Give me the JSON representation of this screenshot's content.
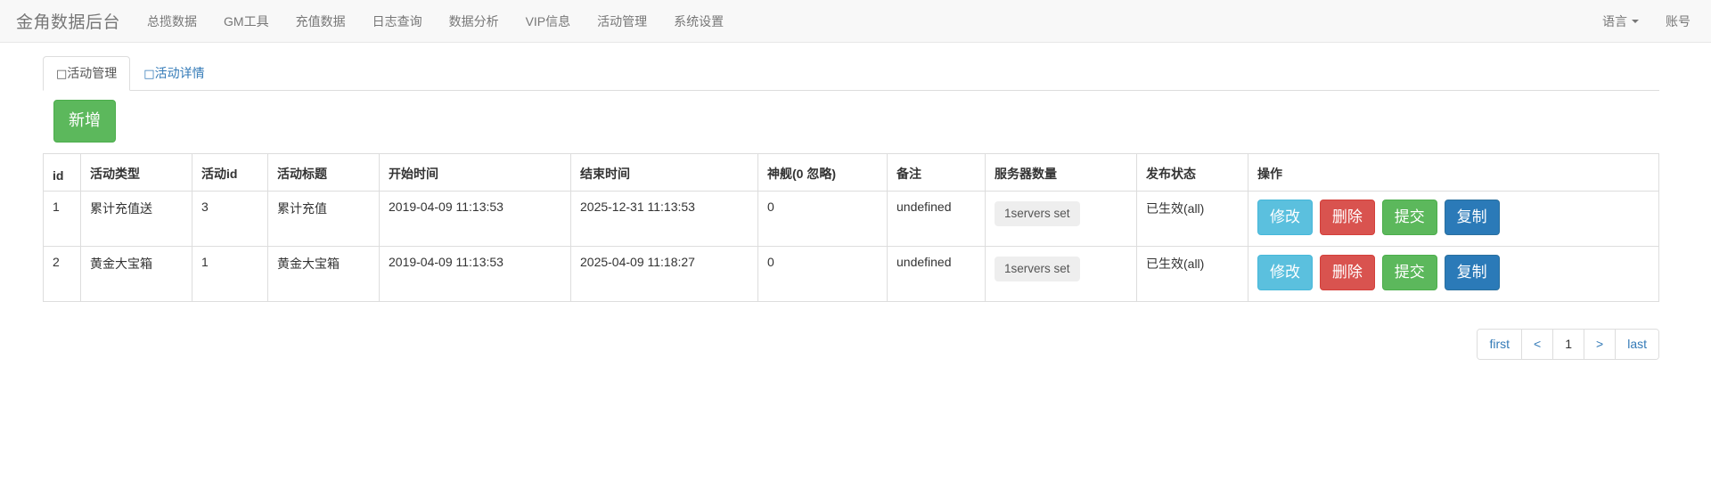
{
  "navbar": {
    "brand": "金角数据后台",
    "links": [
      {
        "label": "总揽数据"
      },
      {
        "label": "GM工具"
      },
      {
        "label": "充值数据"
      },
      {
        "label": "日志查询"
      },
      {
        "label": "数据分析"
      },
      {
        "label": "VIP信息"
      },
      {
        "label": "活动管理"
      },
      {
        "label": "系统设置"
      }
    ],
    "language": "语言",
    "account": "账号"
  },
  "tabs": [
    {
      "glyph": "□",
      "label": "活动管理",
      "active": true
    },
    {
      "glyph": "□",
      "label": "活动详情",
      "active": false
    }
  ],
  "toolbar": {
    "new_label": "新增"
  },
  "table": {
    "headers": [
      "id",
      "活动类型",
      "活动id",
      "活动标题",
      "开始时间",
      "结束时间",
      "神舰(0 忽略)",
      "备注",
      "服务器数量",
      "发布状态",
      "操作"
    ],
    "rows": [
      {
        "id": "1",
        "type": "累计充值送",
        "activity_id": "3",
        "title": "累计充值",
        "start_time": "2019-04-09 11:13:53",
        "end_time": "2025-12-31 11:13:53",
        "ship": "0",
        "remark": "undefined",
        "servers": "1servers set",
        "status": "已生效(all)",
        "actions": [
          {
            "label": "修改",
            "style": "info"
          },
          {
            "label": "删除",
            "style": "danger"
          },
          {
            "label": "提交",
            "style": "success"
          },
          {
            "label": "复制",
            "style": "primary"
          }
        ]
      },
      {
        "id": "2",
        "type": "黄金大宝箱",
        "activity_id": "1",
        "title": "黄金大宝箱",
        "start_time": "2019-04-09 11:13:53",
        "end_time": "2025-04-09 11:18:27",
        "ship": "0",
        "remark": "undefined",
        "servers": "1servers set",
        "status": "已生效(all)",
        "actions": [
          {
            "label": "修改",
            "style": "info"
          },
          {
            "label": "删除",
            "style": "danger"
          },
          {
            "label": "提交",
            "style": "success"
          },
          {
            "label": "复制",
            "style": "primary"
          }
        ]
      }
    ]
  },
  "pagination": {
    "first": "first",
    "prev": "<",
    "current": "1",
    "next": ">",
    "last": "last"
  },
  "colors": {
    "navbar_bg": "#f8f8f8",
    "nav_text": "#777777",
    "link": "#337ab7",
    "success": "#5cb85c",
    "info": "#5bc0de",
    "danger": "#d9534f",
    "primary": "#2b7ab8",
    "border": "#dddddd"
  }
}
